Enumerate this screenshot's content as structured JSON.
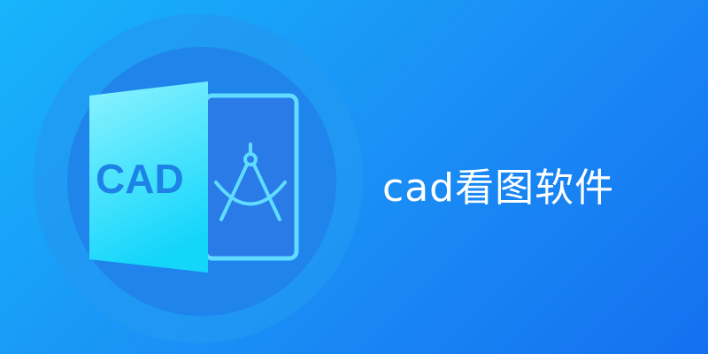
{
  "banner": {
    "title": "cad看图软件",
    "icon_label": "CAD",
    "icon": "cad-file-compass-icon"
  },
  "colors": {
    "background_start": "#17b4fb",
    "background_end": "#1470f0",
    "door": "#5fe6ff",
    "frame": "#5fdcff",
    "logo_text": "#1c82e6"
  }
}
